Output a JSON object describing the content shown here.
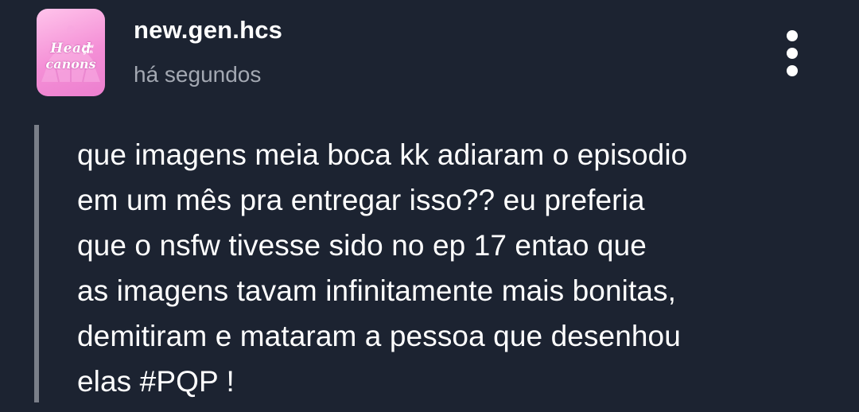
{
  "post": {
    "avatar_text_line1": "Head",
    "avatar_text_line2": "canons",
    "avatar_small_text": "new gen",
    "username": "new.gen.hcs",
    "timestamp": "há segundos",
    "menu_icon": "more-vertical-icon",
    "body": "que imagens meia boca kk adiaram o episodio\nem um mês pra entregar isso?? eu preferia\nque o nsfw tivesse sido no ep 17 entao que\nas imagens tavam infinitamente mais bonitas,\ndemitiram e mataram a pessoa que desenhou\nelas #PQP !"
  },
  "colors": {
    "background": "#1c2331",
    "username": "#ffffff",
    "timestamp": "#a3a8b2",
    "quote_bar": "#7a7f89",
    "avatar_pink": "#f48fd6"
  }
}
